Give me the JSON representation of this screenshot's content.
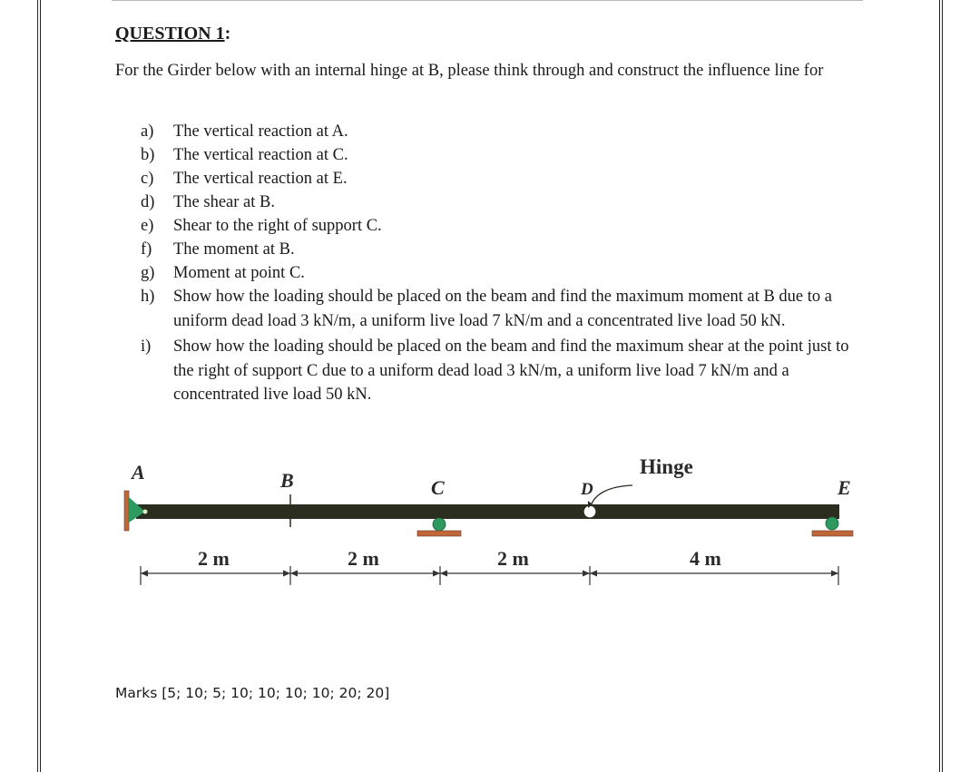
{
  "document": {
    "title": "QUESTION 1",
    "title_suffix": ":",
    "intro": "For the Girder below with an internal hinge at B, please think through and construct the influence line for",
    "items": [
      {
        "label": "a)",
        "text": "The vertical reaction at A."
      },
      {
        "label": "b)",
        "text": "The vertical reaction at C."
      },
      {
        "label": "c)",
        "text": "The vertical reaction at E."
      },
      {
        "label": "d)",
        "text": "The shear at B."
      },
      {
        "label": "e)",
        "text": "Shear to the right of support C."
      },
      {
        "label": "f)",
        "text": "The moment at B."
      },
      {
        "label": "g)",
        "text": "Moment at point C."
      },
      {
        "label": "h)",
        "text": "Show how the loading should be placed on the beam and find the maximum moment at B due to a uniform dead load 3 kN/m, a uniform live load 7 kN/m and a concentrated live load 50 kN."
      },
      {
        "label": "i)",
        "text": "Show how the loading should be placed on the beam and find the maximum shear at the point just to the right of support C due to a uniform dead load 3 kN/m, a uniform live load 7 kN/m and a concentrated live load 50 kN."
      }
    ],
    "marks": "Marks [5; 10; 5; 10; 10; 10; 10; 20; 20]"
  },
  "figure": {
    "points": {
      "A": "A",
      "B": "B",
      "C": "C",
      "D": "D",
      "E": "E"
    },
    "hinge_label": "Hinge",
    "spans": [
      "2 m",
      "2 m",
      "2 m",
      "4 m"
    ],
    "colors": {
      "beam": "#2b2d1f",
      "support_green": "#2e9a5f",
      "support_base": "#c0673a",
      "dimension": "#333333"
    }
  }
}
